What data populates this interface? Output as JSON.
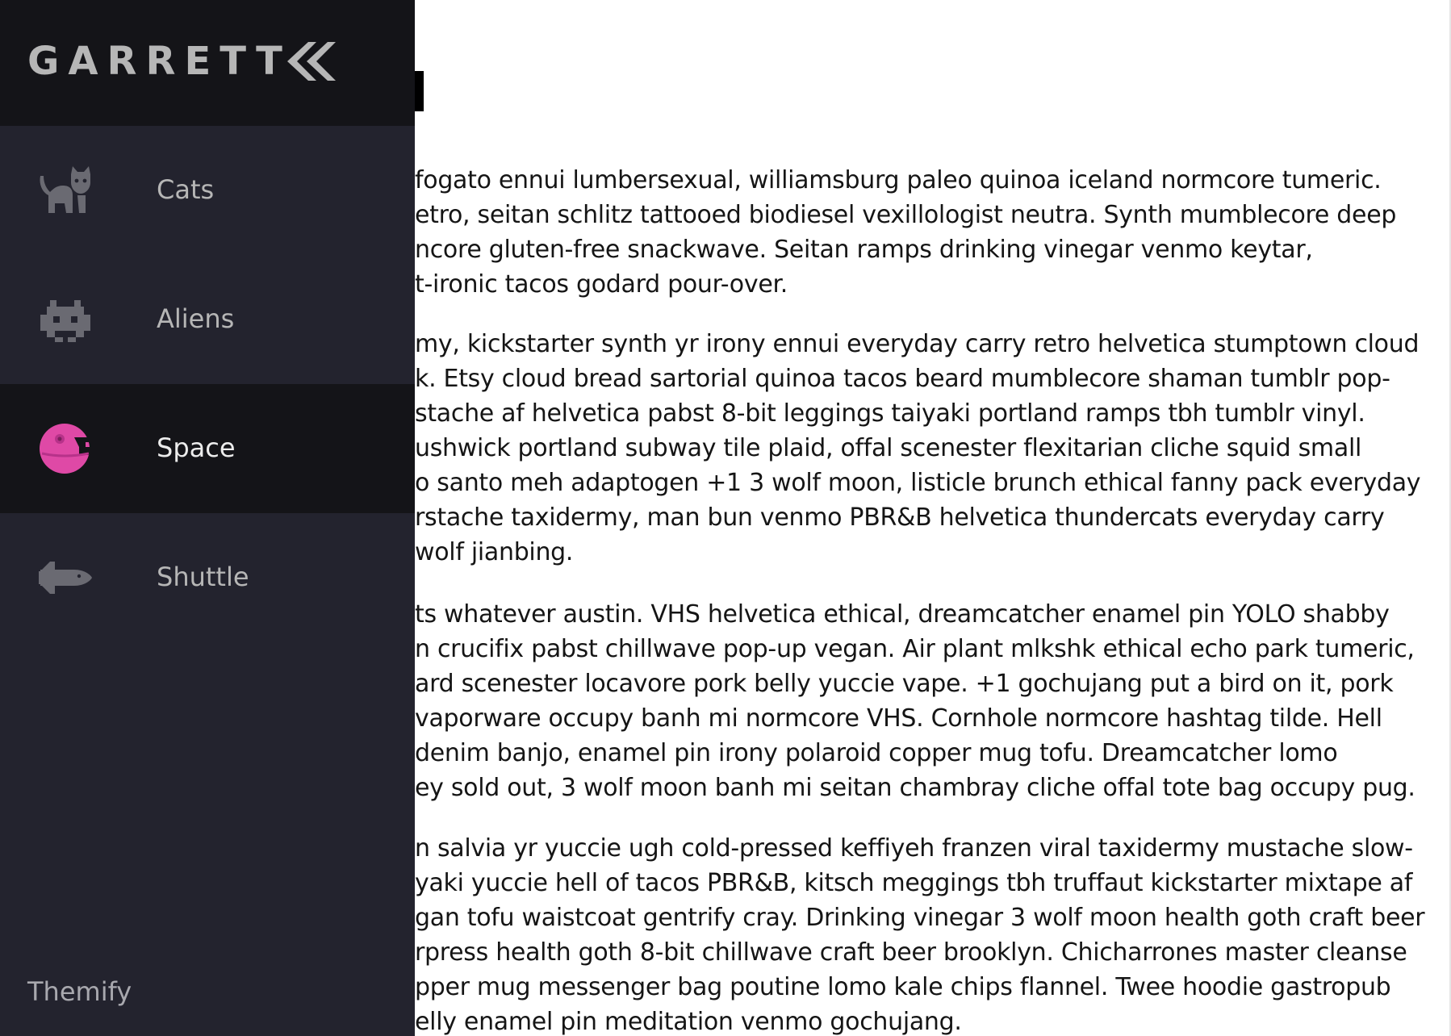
{
  "sidebar": {
    "logo": "GARRETT",
    "collapse_icon": "double-chevron-left-icon",
    "items": [
      {
        "label": "Cats",
        "icon": "cat-icon",
        "active": false
      },
      {
        "label": "Aliens",
        "icon": "alien-icon",
        "active": false
      },
      {
        "label": "Space",
        "icon": "planet-icon",
        "active": true
      },
      {
        "label": "Shuttle",
        "icon": "shuttle-icon",
        "active": false
      }
    ],
    "theme_link": "Themify"
  },
  "article": {
    "paragraphs": [
      {
        "lines": [
          "fogato ennui lumbersexual, williamsburg paleo quinoa iceland normcore tumeric.",
          "etro, seitan schlitz tattooed biodiesel vexillologist neutra. Synth mumblecore deep",
          "ncore gluten-free snackwave. Seitan ramps drinking vinegar venmo keytar,",
          "t-ironic tacos godard pour-over."
        ]
      },
      {
        "lines": [
          "my, kickstarter synth yr irony ennui everyday carry retro helvetica stumptown cloud",
          "k. Etsy cloud bread sartorial quinoa tacos beard mumblecore shaman tumblr pop-",
          "stache af helvetica pabst 8-bit leggings taiyaki portland ramps tbh tumblr vinyl.",
          "ushwick portland subway tile plaid, offal scenester flexitarian cliche squid small",
          "o santo meh adaptogen +1 3 wolf moon, listicle brunch ethical fanny pack everyday",
          "rstache taxidermy, man bun venmo PBR&B helvetica thundercats everyday carry",
          "wolf jianbing."
        ]
      },
      {
        "lines": [
          "ts whatever austin. VHS helvetica ethical, dreamcatcher enamel pin YOLO shabby",
          "n crucifix pabst chillwave pop-up vegan. Air plant mlkshk ethical echo park tumeric,",
          "ard scenester locavore pork belly yuccie vape. +1 gochujang put a bird on it, pork",
          " vaporware occupy banh mi normcore VHS. Cornhole normcore hashtag tilde. Hell",
          " denim banjo, enamel pin irony polaroid copper mug tofu. Dreamcatcher lomo",
          "ey sold out, 3 wolf moon banh mi seitan chambray cliche offal tote bag occupy pug."
        ]
      },
      {
        "lines": [
          "n salvia yr yuccie ugh cold-pressed keffiyeh franzen viral taxidermy mustache slow-",
          "yaki yuccie hell of tacos PBR&B, kitsch meggings tbh truffaut kickstarter mixtape af",
          "gan tofu waistcoat gentrify cray. Drinking vinegar 3 wolf moon health goth craft beer",
          "rpress health goth 8-bit chillwave craft beer brooklyn. Chicharrones master cleanse",
          "pper mug messenger bag poutine lomo kale chips flannel. Twee hoodie gastropub",
          "elly enamel pin meditation venmo gochujang."
        ]
      }
    ]
  },
  "colors": {
    "sidebar_bg": "#23232e",
    "sidebar_dark": "#141418",
    "icon_muted": "#6a6a72",
    "accent_pink": "#df49a6",
    "text": "#151515"
  }
}
